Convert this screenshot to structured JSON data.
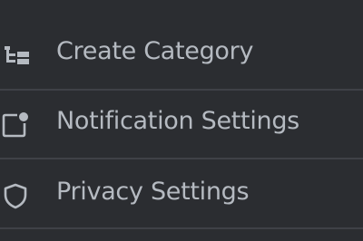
{
  "menu": {
    "items": [
      {
        "label": "Create Category",
        "icon": "create-category-icon"
      },
      {
        "label": "Notification Settings",
        "icon": "notification-settings-icon"
      },
      {
        "label": "Privacy Settings",
        "icon": "shield-icon"
      }
    ]
  },
  "colors": {
    "background": "#2b2d31",
    "text": "#b5bac1",
    "icon": "#b5bac1",
    "divider": "#3f4147"
  }
}
